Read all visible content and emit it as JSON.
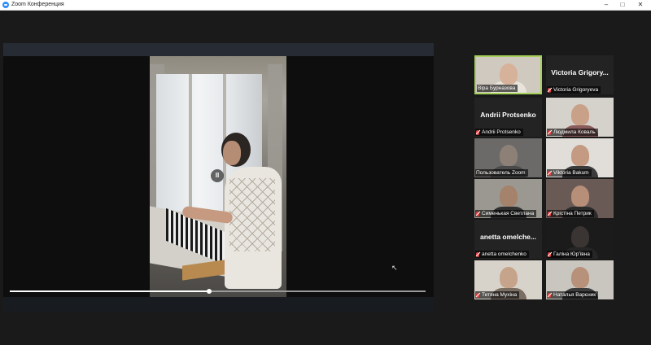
{
  "window": {
    "title": "Zoom Конференция",
    "min": "–",
    "max": "□",
    "close": "✕"
  },
  "share": {
    "pause_glyph": "II",
    "progress": 0.48
  },
  "participants": [
    {
      "name": "Віра Бурназова",
      "big": "",
      "muted": false,
      "active": true,
      "bg": "#cfc9c0",
      "skin": "#d7b29a",
      "shirt": "#e8e4dc"
    },
    {
      "name": "Victoria Grigoryeva",
      "big": "Victoria Grigory...",
      "muted": true,
      "active": false
    },
    {
      "name": "Andrii Protsenko",
      "big": "Andrii Protsenko",
      "muted": true,
      "active": false
    },
    {
      "name": "Людмила Коваль",
      "big": "",
      "muted": true,
      "active": false,
      "bg": "#d5d2cc",
      "skin": "#c9a088",
      "shirt": "#8b5c5c"
    },
    {
      "name": "Пользователь Zoom",
      "big": "",
      "muted": false,
      "active": false,
      "bg": "#6b6a68",
      "skin": "#8d8177",
      "shirt": "#4a4a4a"
    },
    {
      "name": "Viktoria Bakum",
      "big": "",
      "muted": true,
      "active": false,
      "bg": "#e1ded9",
      "skin": "#c49a82",
      "shirt": "#3b3b3b"
    },
    {
      "name": "Сименькая Светлана",
      "big": "",
      "muted": true,
      "active": false,
      "bg": "#9a9890",
      "skin": "#a5826c",
      "shirt": "#2f2f2f"
    },
    {
      "name": "Крістіна Петрик",
      "big": "",
      "muted": true,
      "active": false,
      "bg": "#6a5a55",
      "skin": "#b78e78",
      "shirt": "#2b2b2b"
    },
    {
      "name": "anetta omelchenko",
      "big": "anetta omelche...",
      "muted": true,
      "active": false
    },
    {
      "name": "Галіна Юр'ївна",
      "big": "",
      "muted": true,
      "active": false,
      "bg": "#1b1b1b",
      "skin": "#3a3532",
      "shirt": "#262626"
    },
    {
      "name": "Тетяна Мухіна",
      "big": "",
      "muted": true,
      "active": false,
      "bg": "#d8d3ca",
      "skin": "#c6a38b",
      "shirt": "#7a6d62"
    },
    {
      "name": "Наталья Варєник",
      "big": "",
      "muted": true,
      "active": false,
      "bg": "#c9c6bf",
      "skin": "#b8917a",
      "shirt": "#3d3d3d"
    }
  ],
  "colors": {
    "active_border": "#a5d15a",
    "mute": "#e23d3d",
    "zoom_blue": "#2d8cff"
  }
}
